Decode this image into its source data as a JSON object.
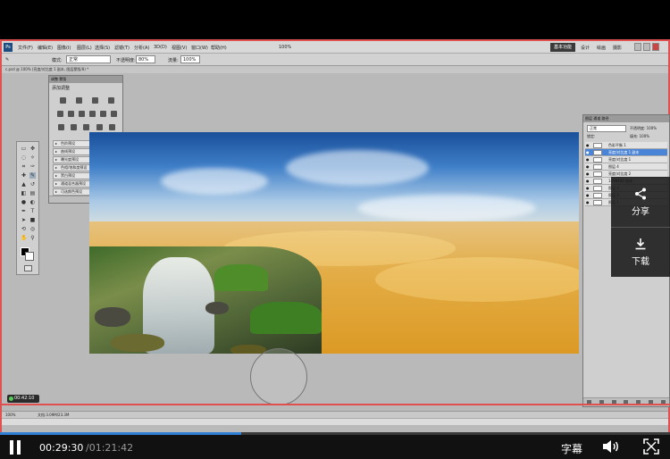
{
  "photoshop": {
    "logo": "Ps",
    "menu": [
      "文件(F)",
      "编辑(E)",
      "图像(I)",
      "图层(L)",
      "选择(S)",
      "滤镜(T)",
      "分析(A)",
      "3D(D)",
      "视图(V)",
      "窗口(W)",
      "帮助(H)"
    ],
    "zoom": "100%",
    "workspace_btn": "基本功能",
    "workspace_items": [
      "设计",
      "绘画",
      "摄影"
    ],
    "options": {
      "mode_label": "模式:",
      "mode_value": "正常",
      "opacity_label": "不透明度:",
      "opacity_value": "80%",
      "flow_label": "流量:",
      "flow_value": "100%"
    },
    "document_tab": "c.psd @ 100% (亮度/对比度 1 副本, 图层蒙版/8) *",
    "adjustments": {
      "tabs": "调整  蒙版",
      "title": "添加调整",
      "presets": [
        "色阶预设",
        "曲线预设",
        "曝光度预设",
        "色相/饱和度预设",
        "黑白预设",
        "通道混合器预设",
        "可选颜色预设"
      ]
    },
    "layers": {
      "tabs": "图层  通道  路径",
      "blend_mode": "正常",
      "opacity_label": "不透明度:",
      "opacity_value": "100%",
      "lock_label": "锁定:",
      "fill_label": "填充:",
      "fill_value": "100%",
      "rows": [
        {
          "name": "色彩平衡 1",
          "selected": false
        },
        {
          "name": "亮度/对比度 1 副本",
          "selected": true
        },
        {
          "name": "亮度/对比度 1",
          "selected": false
        },
        {
          "name": "图层 4",
          "selected": false
        },
        {
          "name": "亮度/对比度 2",
          "selected": false
        },
        {
          "name": "1498484 副本",
          "selected": false
        },
        {
          "name": "图层 3",
          "selected": false
        },
        {
          "name": "图层 2",
          "selected": false
        },
        {
          "name": "图层 1",
          "selected": false
        }
      ]
    },
    "status": {
      "zoom": "100%",
      "doc": "文档:3.09M/23.3M"
    },
    "recording_time": "00:42:10"
  },
  "share_panel": {
    "share_label": "分享",
    "download_label": "下载"
  },
  "player": {
    "current_time": "00:29:30",
    "total_time": "/01:21:42",
    "progress": 0.36,
    "subtitle_label": "字幕"
  },
  "colors": {
    "accent_red": "#e05050",
    "progress_blue": "#2f7fd4"
  }
}
